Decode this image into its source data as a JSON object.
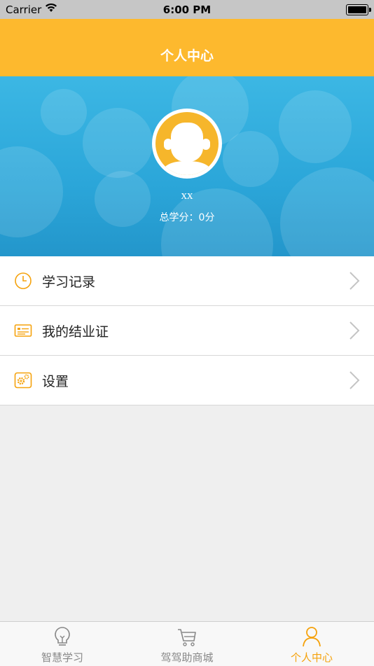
{
  "status_bar": {
    "carrier": "Carrier",
    "time": "6:00 PM"
  },
  "nav": {
    "title": "个人中心"
  },
  "profile": {
    "username": "xx",
    "score_text": "总学分：0分"
  },
  "menu": {
    "items": [
      {
        "label": "学习记录",
        "icon": "clock-icon"
      },
      {
        "label": "我的结业证",
        "icon": "certificate-icon"
      },
      {
        "label": "设置",
        "icon": "settings-icon"
      }
    ]
  },
  "tabs": [
    {
      "label": "智慧学习",
      "icon": "lightbulb-icon",
      "active": false
    },
    {
      "label": "驾驾助商城",
      "icon": "cart-icon",
      "active": false
    },
    {
      "label": "个人中心",
      "icon": "person-icon",
      "active": true
    }
  ],
  "colors": {
    "accent": "#fdb92e",
    "header_blue": "#2ba6d9",
    "tab_active": "#f5a20c"
  }
}
